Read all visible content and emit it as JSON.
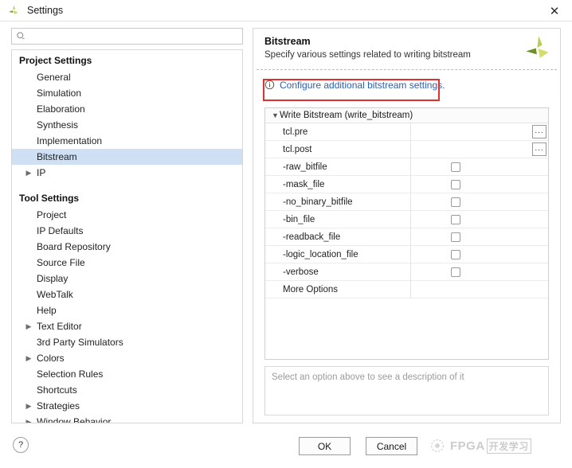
{
  "window": {
    "title": "Settings",
    "logo_icon": "vivado-leaf-icon",
    "close_icon": "close-icon"
  },
  "search": {
    "icon": "search-icon",
    "value": "",
    "placeholder": ""
  },
  "sidebar": {
    "groups": [
      {
        "title": "Project Settings",
        "items": [
          {
            "label": "General",
            "expandable": false,
            "selected": false
          },
          {
            "label": "Simulation",
            "expandable": false,
            "selected": false
          },
          {
            "label": "Elaboration",
            "expandable": false,
            "selected": false
          },
          {
            "label": "Synthesis",
            "expandable": false,
            "selected": false
          },
          {
            "label": "Implementation",
            "expandable": false,
            "selected": false
          },
          {
            "label": "Bitstream",
            "expandable": false,
            "selected": true
          },
          {
            "label": "IP",
            "expandable": true,
            "selected": false
          }
        ]
      },
      {
        "title": "Tool Settings",
        "items": [
          {
            "label": "Project",
            "expandable": false,
            "selected": false
          },
          {
            "label": "IP Defaults",
            "expandable": false,
            "selected": false
          },
          {
            "label": "Board Repository",
            "expandable": false,
            "selected": false
          },
          {
            "label": "Source File",
            "expandable": false,
            "selected": false
          },
          {
            "label": "Display",
            "expandable": false,
            "selected": false
          },
          {
            "label": "WebTalk",
            "expandable": false,
            "selected": false
          },
          {
            "label": "Help",
            "expandable": false,
            "selected": false
          },
          {
            "label": "Text Editor",
            "expandable": true,
            "selected": false
          },
          {
            "label": "3rd Party Simulators",
            "expandable": false,
            "selected": false
          },
          {
            "label": "Colors",
            "expandable": true,
            "selected": false
          },
          {
            "label": "Selection Rules",
            "expandable": false,
            "selected": false
          },
          {
            "label": "Shortcuts",
            "expandable": false,
            "selected": false
          },
          {
            "label": "Strategies",
            "expandable": true,
            "selected": false
          },
          {
            "label": "Window Behavior",
            "expandable": true,
            "selected": false
          }
        ]
      }
    ],
    "chevron_icon": "chevron-right-icon",
    "selected_bg": "#cfe0f4"
  },
  "panel": {
    "title": "Bitstream",
    "subtitle": "Specify various settings related to writing bitstream",
    "logo_icon": "vivado-leaf-icon",
    "link": {
      "icon": "info-circle-icon",
      "text": "Configure additional bitstream settings.",
      "color": "#2b5fb4",
      "highlight_color": "#e03030"
    },
    "group": {
      "label": "Write Bitstream (write_bitstream)",
      "expanded": true,
      "chevron_icon": "chevron-down-icon"
    },
    "options": [
      {
        "name": "tcl.pre",
        "type": "text",
        "value": "",
        "browse_label": "..."
      },
      {
        "name": "tcl.post",
        "type": "text",
        "value": "",
        "browse_label": "..."
      },
      {
        "name": "-raw_bitfile",
        "type": "checkbox",
        "checked": false
      },
      {
        "name": "-mask_file",
        "type": "checkbox",
        "checked": false
      },
      {
        "name": "-no_binary_bitfile",
        "type": "checkbox",
        "checked": false
      },
      {
        "name": "-bin_file",
        "type": "checkbox",
        "checked": false
      },
      {
        "name": "-readback_file",
        "type": "checkbox",
        "checked": false
      },
      {
        "name": "-logic_location_file",
        "type": "checkbox",
        "checked": false
      },
      {
        "name": "-verbose",
        "type": "checkbox",
        "checked": false
      },
      {
        "name": "More Options",
        "type": "none"
      }
    ],
    "description_placeholder": "Select an option above to see a description of it"
  },
  "footer": {
    "help_label": "?",
    "ok_label": "OK",
    "cancel_label": "Cancel"
  },
  "watermark": {
    "text": "FPGA",
    "cn_text": "开发学习"
  }
}
